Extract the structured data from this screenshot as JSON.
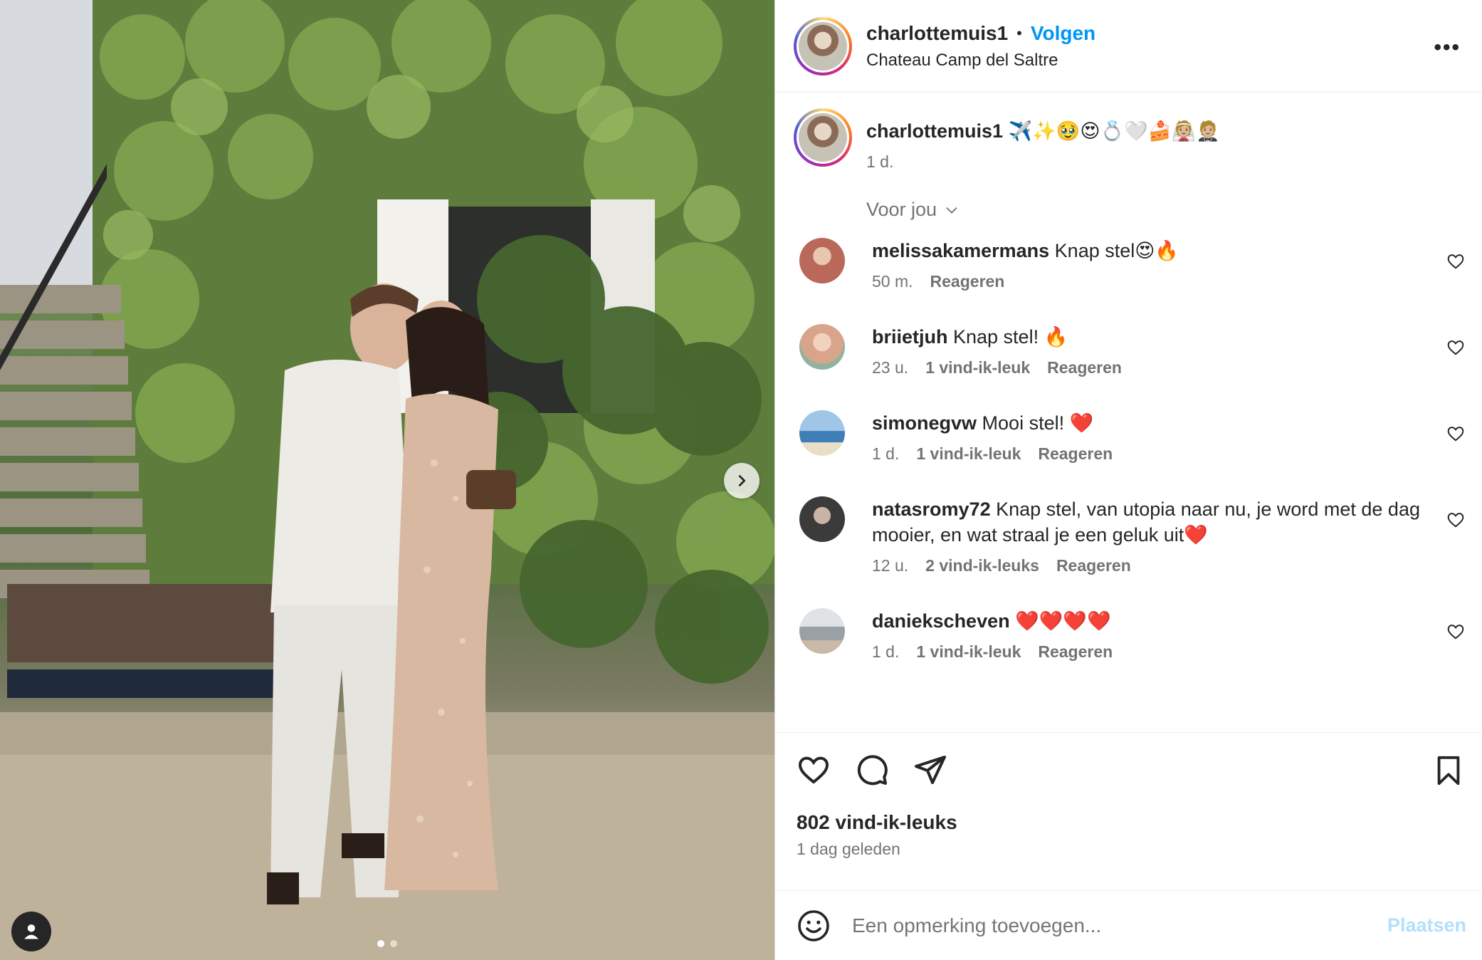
{
  "post": {
    "author": "charlottemuis1",
    "separator": "•",
    "follow_label": "Volgen",
    "location": "Chateau Camp del Saltre",
    "more_label": "•••"
  },
  "caption": {
    "username": "charlottemuis1",
    "text": " ✈️✨🥹😍💍🤍🍰👰🏼🤵🏼",
    "time": "1 d."
  },
  "for_you_label": "Voor jou",
  "comments": [
    {
      "username": "melissakamermans",
      "text": " Knap stel😍🔥",
      "time": "50 m.",
      "likes": "",
      "reply": "Reageren",
      "avatar_color": "#b9685a"
    },
    {
      "username": "briietjuh",
      "text": " Knap stel! 🔥",
      "time": "23 u.",
      "likes": "1 vind-ik-leuk",
      "reply": "Reageren",
      "avatar_color": "#d8a48a"
    },
    {
      "username": "simonegvw",
      "text": " Mooi stel! ❤️",
      "time": "1 d.",
      "likes": "1 vind-ik-leuk",
      "reply": "Reageren",
      "avatar_color": "#3f7fb8"
    },
    {
      "username": "natasromy72",
      "text": " Knap stel, van utopia naar nu, je word met de dag mooier, en wat straal je een geluk uit❤️",
      "time": "12 u.",
      "likes": "2 vind-ik-leuks",
      "reply": "Reageren",
      "avatar_color": "#3b3b3b"
    },
    {
      "username": "daniekscheven",
      "text": " ❤️❤️❤️❤️",
      "time": "1 d.",
      "likes": "1 vind-ik-leuk",
      "reply": "Reageren",
      "avatar_color": "#9aa1a6"
    }
  ],
  "likes_count": "802 vind-ik-leuks",
  "posted_ago": "1 dag geleden",
  "add_comment": {
    "placeholder": "Een opmerking toevoegen...",
    "post_label": "Plaatsen"
  },
  "colors": {
    "accent": "#0095f6",
    "post_disabled": "#b2dffc",
    "text": "#262626",
    "secondary": "#737373"
  },
  "icons": {
    "like": "heart-icon",
    "comment": "comment-icon",
    "share": "paper-plane-icon",
    "save": "bookmark-icon",
    "emoji": "smiley-icon",
    "next": "chevron-right-icon",
    "tag": "user-tag-icon",
    "more": "more-options-icon"
  },
  "carousel": {
    "current": 1,
    "total": 2
  }
}
